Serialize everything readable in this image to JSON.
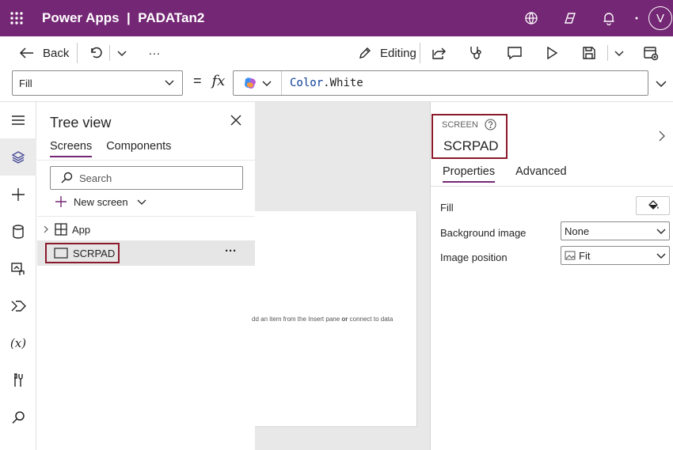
{
  "app": {
    "title": "Power Apps  |  PADATan2",
    "avatar_initial": "V",
    "top_icons": [
      "environment-icon",
      "copilot-icon",
      "bell-icon",
      "more-dot-icon"
    ]
  },
  "commandbar": {
    "back_label": "Back",
    "more_label": "···",
    "editing_label": "Editing"
  },
  "formula_bar": {
    "property": "Fill",
    "eq": "=",
    "fx": "fx",
    "formula_object": "Color",
    "formula_member": ".White"
  },
  "tree_view": {
    "title": "Tree view",
    "tabs": [
      "Screens",
      "Components"
    ],
    "search_placeholder": "Search",
    "new_screen_label": "New screen",
    "nodes": [
      {
        "label": "App"
      },
      {
        "label": "SCRPAD"
      }
    ],
    "node_more": "···"
  },
  "canvas": {
    "hint_prefix": "dd an item from the Insert pane ",
    "hint_or": "or",
    "hint_suffix": " connect to data"
  },
  "properties": {
    "type_label": "SCREEN",
    "name": "SCRPAD",
    "tabs": [
      "Properties",
      "Advanced"
    ],
    "rows": [
      {
        "label": "Fill"
      },
      {
        "label": "Background image",
        "value": "None"
      },
      {
        "label": "Image position",
        "value": "Fit"
      }
    ]
  },
  "colors": {
    "brand": "#742774",
    "highlight_border": "#8b1a2b"
  }
}
